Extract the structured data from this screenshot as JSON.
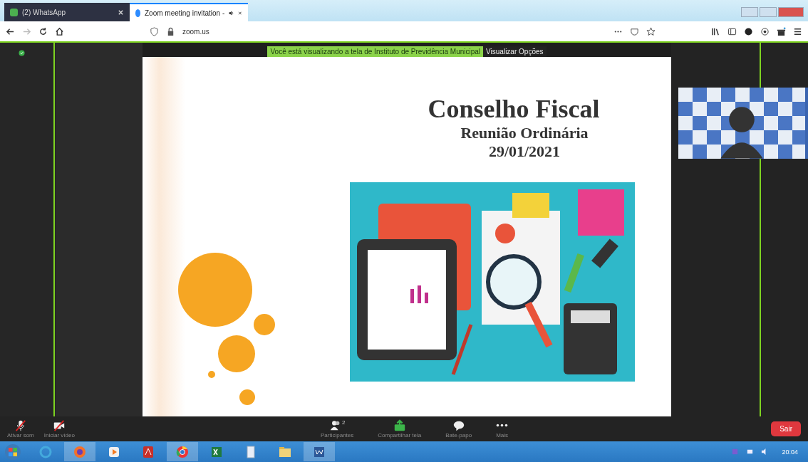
{
  "tabs": [
    {
      "label": "(2) WhatsApp",
      "selected": false,
      "audio": false
    },
    {
      "label": "Zoom meeting invitation -",
      "selected": true,
      "audio": true
    }
  ],
  "address_bar": {
    "url": "zoom.us"
  },
  "share_banner": {
    "text": "Você está visualizando a tela de Instituto de Previdência Municipal",
    "button": "Visualizar Opções"
  },
  "slide": {
    "title": "Conselho Fiscal",
    "subtitle": "Reunião Ordinária",
    "date": "29/01/2021"
  },
  "meeting_controls": [
    {
      "kind": "audio",
      "label": "Ativar som",
      "crossed": true
    },
    {
      "kind": "video",
      "label": "Iniciar vídeo",
      "crossed": true
    }
  ],
  "center_controls": [
    {
      "kind": "participants",
      "label": "Participantes",
      "count": "2"
    },
    {
      "kind": "share",
      "label": "Compartilhar tela"
    },
    {
      "kind": "chat",
      "label": "Bate-papo"
    },
    {
      "kind": "more",
      "label": "Mais"
    }
  ],
  "leave_button": "Sair",
  "clock": "20:04"
}
